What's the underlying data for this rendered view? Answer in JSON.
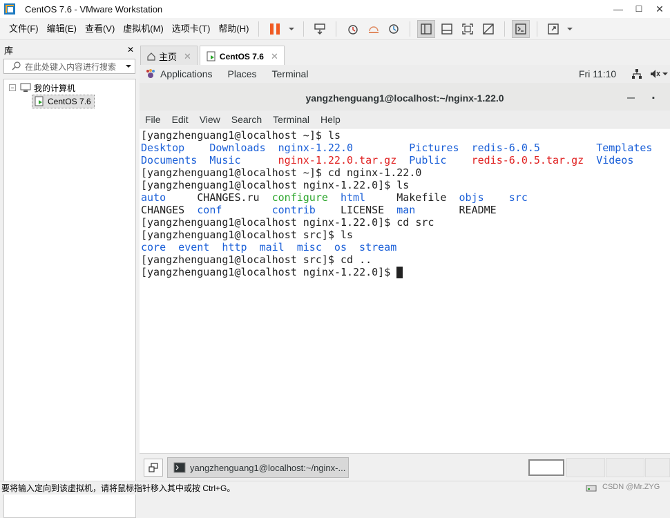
{
  "window": {
    "title": "CentOS 7.6 - VMware Workstation",
    "minimize": "—",
    "maximize": "☐",
    "close": "✕"
  },
  "menu": [
    "文件(F)",
    "编辑(E)",
    "查看(V)",
    "虚拟机(M)",
    "选项卡(T)",
    "帮助(H)"
  ],
  "library": {
    "title": "库",
    "close": "✕",
    "search_placeholder": "在此处键入内容进行搜索",
    "tree_root": "我的计算机",
    "tree_vm": "CentOS 7.6",
    "expander": "−"
  },
  "tabs": [
    {
      "label": "主页",
      "close": "✕"
    },
    {
      "label": "CentOS 7.6",
      "close": "✕"
    }
  ],
  "gnome": {
    "applications": "Applications",
    "places": "Places",
    "terminal": "Terminal",
    "clock": "Fri 11:10"
  },
  "terminal": {
    "title": "yangzhenguang1@localhost:~/nginx-1.22.0",
    "minimize": "—",
    "close": "▪",
    "menu": [
      "File",
      "Edit",
      "View",
      "Search",
      "Terminal",
      "Help"
    ],
    "lines": [
      [
        {
          "t": "[yangzhenguang1@localhost ~]$ ls",
          "c": 0
        }
      ],
      [
        {
          "t": "Desktop",
          "c": 0,
          "k": "blue"
        },
        {
          "t": "Downloads",
          "c": 11,
          "k": "blue"
        },
        {
          "t": "nginx-1.22.0",
          "c": 22,
          "k": "blue"
        },
        {
          "t": "Pictures",
          "c": 43,
          "k": "blue"
        },
        {
          "t": "redis-6.0.5",
          "c": 53,
          "k": "blue"
        },
        {
          "t": "Templates",
          "c": 73,
          "k": "blue"
        }
      ],
      [
        {
          "t": "Documents",
          "c": 0,
          "k": "blue"
        },
        {
          "t": "Music",
          "c": 11,
          "k": "blue"
        },
        {
          "t": "nginx-1.22.0.tar.gz",
          "c": 22,
          "k": "red"
        },
        {
          "t": "Public",
          "c": 43,
          "k": "blue"
        },
        {
          "t": "redis-6.0.5.tar.gz",
          "c": 53,
          "k": "red"
        },
        {
          "t": "Videos",
          "c": 73,
          "k": "blue"
        }
      ],
      [
        {
          "t": "[yangzhenguang1@localhost ~]$ cd nginx-1.22.0",
          "c": 0
        }
      ],
      [
        {
          "t": "[yangzhenguang1@localhost nginx-1.22.0]$ ls",
          "c": 0
        }
      ],
      [
        {
          "t": "auto",
          "c": 0,
          "k": "blue"
        },
        {
          "t": "CHANGES.ru",
          "c": 9
        },
        {
          "t": "configure",
          "c": 21,
          "k": "green"
        },
        {
          "t": "html",
          "c": 32,
          "k": "blue"
        },
        {
          "t": "Makefile",
          "c": 41
        },
        {
          "t": "objs",
          "c": 51,
          "k": "blue"
        },
        {
          "t": "src",
          "c": 59,
          "k": "blue"
        }
      ],
      [
        {
          "t": "CHANGES",
          "c": 0
        },
        {
          "t": "conf",
          "c": 9,
          "k": "blue"
        },
        {
          "t": "contrib",
          "c": 21,
          "k": "blue"
        },
        {
          "t": "LICENSE",
          "c": 32
        },
        {
          "t": "man",
          "c": 41,
          "k": "blue"
        },
        {
          "t": "README",
          "c": 51
        }
      ],
      [
        {
          "t": "[yangzhenguang1@localhost nginx-1.22.0]$ cd src",
          "c": 0
        }
      ],
      [
        {
          "t": "[yangzhenguang1@localhost src]$ ls",
          "c": 0
        }
      ],
      [
        {
          "t": "core",
          "c": 0,
          "k": "blue"
        },
        {
          "t": "event",
          "c": 6,
          "k": "blue"
        },
        {
          "t": "http",
          "c": 13,
          "k": "blue"
        },
        {
          "t": "mail",
          "c": 19,
          "k": "blue"
        },
        {
          "t": "misc",
          "c": 25,
          "k": "blue"
        },
        {
          "t": "os",
          "c": 31,
          "k": "blue"
        },
        {
          "t": "stream",
          "c": 35,
          "k": "blue"
        }
      ],
      [
        {
          "t": "[yangzhenguang1@localhost src]$ cd ..",
          "c": 0
        }
      ],
      [
        {
          "t": "[yangzhenguang1@localhost nginx-1.22.0]$ ",
          "c": 0
        }
      ]
    ]
  },
  "taskbar": {
    "window_label": "yangzhenguang1@localhost:~/nginx-..."
  },
  "status": {
    "hint": "要将输入定向到该虚拟机，请将鼠标指针移入其中或按 Ctrl+G。",
    "watermark": "CSDN @Mr.ZYG"
  },
  "colors": {
    "blue": "#1a5fd8",
    "red": "#e02020",
    "green": "#2aa52a",
    "pause": "#f05a22"
  }
}
